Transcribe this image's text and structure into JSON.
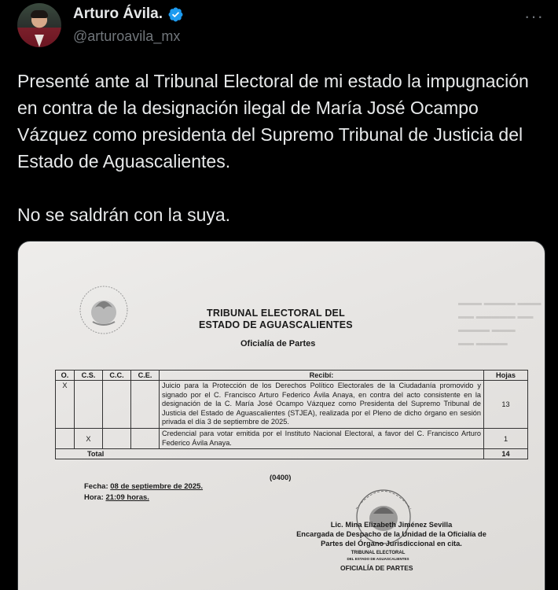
{
  "author": {
    "display_name": "Arturo Ávila.",
    "handle": "@arturoavila_mx",
    "verified_icon": "verified-badge-icon",
    "verified_color": "#1d9bf0"
  },
  "menu": {
    "label": "···"
  },
  "tweet": {
    "paragraph_1": "Presenté ante al Tribunal Electoral de mi estado la impugnación en contra de la designación ilegal de María José Ocampo Vázquez como presidenta del Supremo Tribunal de Justicia del Estado de Aguascalientes.",
    "paragraph_2": "No se saldrán con la suya."
  },
  "document": {
    "title_line1": "TRIBUNAL ELECTORAL DEL",
    "title_line2": "ESTADO DE AGUASCALIENTES",
    "subtitle": "Oficialía de Partes",
    "table": {
      "headers": [
        "O.",
        "C.S.",
        "C.C.",
        "C.E.",
        "Recibí:",
        "Hojas"
      ],
      "rows": [
        {
          "o": "X",
          "cs": "",
          "cc": "",
          "ce": "",
          "desc": "Juicio para la Protección de los Derechos Político Electorales de la Ciudadanía promovido y signado por el C. Francisco Arturo Federico Ávila Anaya, en contra del acto consistente en la designación de la C. María José Ocampo Vázquez como Presidenta del Supremo Tribunal de Justicia del Estado de Aguascalientes (STJEA), realizada por el Pleno de dicho órgano en sesión privada el día 3 de septiembre de 2025.",
          "hojas": "13"
        },
        {
          "o": "",
          "cs": "X",
          "cc": "",
          "ce": "",
          "desc": "Credencial para votar emitida por el Instituto Nacional Electoral, a favor del C. Francisco Arturo Federico Ávila Anaya.",
          "hojas": "1"
        }
      ],
      "total_label": "Total",
      "total_value": "14"
    },
    "folio": "(0400)",
    "fecha_label": "Fecha:",
    "fecha_value": "08 de septiembre de 2025.",
    "hora_label": "Hora:",
    "hora_value": "21:09 horas.",
    "signer_name": "Lic. Mina Elizabeth Jiménez Sevilla",
    "signer_role_1": "Encargada de Despacho de la Unidad de la Oficialía de",
    "signer_role_2": "Partes del Órgano Jurisdiccional en cita.",
    "stamp_line1": "TRIBUNAL ELECTORAL",
    "stamp_line2": "DEL ESTADO DE AGUASCALIENTES",
    "oficialia_label": "OFICIALÍA DE PARTES"
  }
}
